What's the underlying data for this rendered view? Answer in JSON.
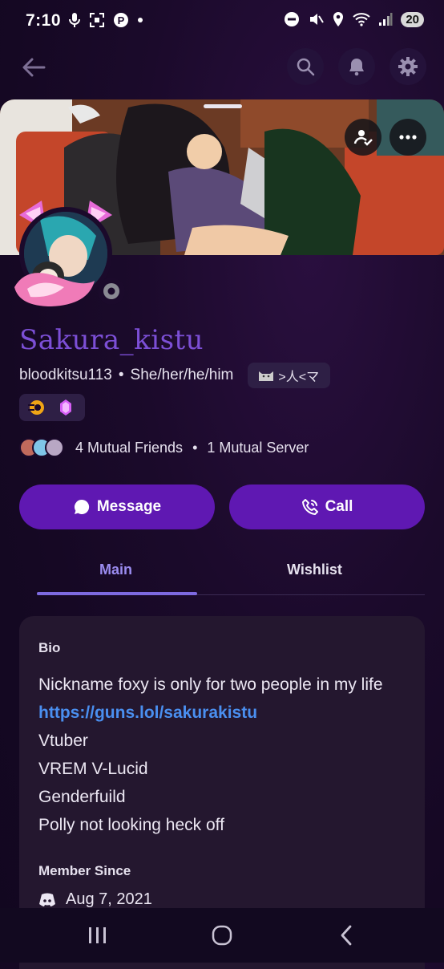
{
  "status_bar": {
    "time": "7:10",
    "battery": "20"
  },
  "profile": {
    "display_name": "Sakura_kistu",
    "username": "bloodkitsu113",
    "pronouns": "She/her/he/him",
    "tag": ">人<マ",
    "mutual_friends": "4 Mutual Friends",
    "mutual_servers": "1 Mutual Server"
  },
  "actions": {
    "message": "Message",
    "call": "Call"
  },
  "tabs": {
    "main": "Main",
    "wishlist": "Wishlist"
  },
  "card": {
    "bio_label": "Bio",
    "bio_lines": [
      "Nickname foxy is only for two people in my life",
      "https://guns.lol/sakurakistu",
      "Vtuber",
      "VREM V-Lucid",
      "Genderfuild",
      "Polly not looking heck off"
    ],
    "member_since_label": "Member Since",
    "member_since": "Aug 7, 2021"
  },
  "colors": {
    "accent": "#5f18b2",
    "display_name": "#7c4fd6",
    "link": "#4a8ff0",
    "tab_active": "#9b8cf0"
  }
}
